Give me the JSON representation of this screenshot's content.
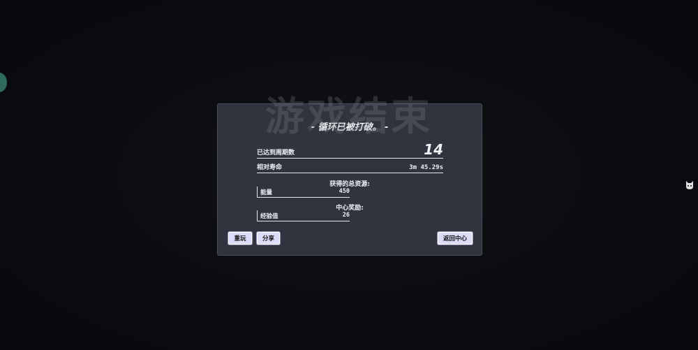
{
  "watermark_title": "游戏结束",
  "dialog": {
    "subtitle": "- 循环已被打破。 -",
    "cycles_label": "已达到周期数",
    "cycles_value": "14",
    "lifespan_label": "相对寿命",
    "lifespan_value": "3m 45.29s",
    "resources_title": "获得的总资源:",
    "resources": [
      {
        "label": "能量",
        "value": "450"
      }
    ],
    "rewards_title": "中心奖励:",
    "rewards": [
      {
        "label": "经验值",
        "value": "26"
      }
    ]
  },
  "buttons": {
    "replay": "重玩",
    "share": "分享",
    "return_center": "返回中心"
  },
  "side_icon": "cat-face-icon",
  "colors": {
    "background": "#0b0c10",
    "panel": "#30343f",
    "button": "#dcdcf8",
    "orb": "#2f6b5a"
  }
}
